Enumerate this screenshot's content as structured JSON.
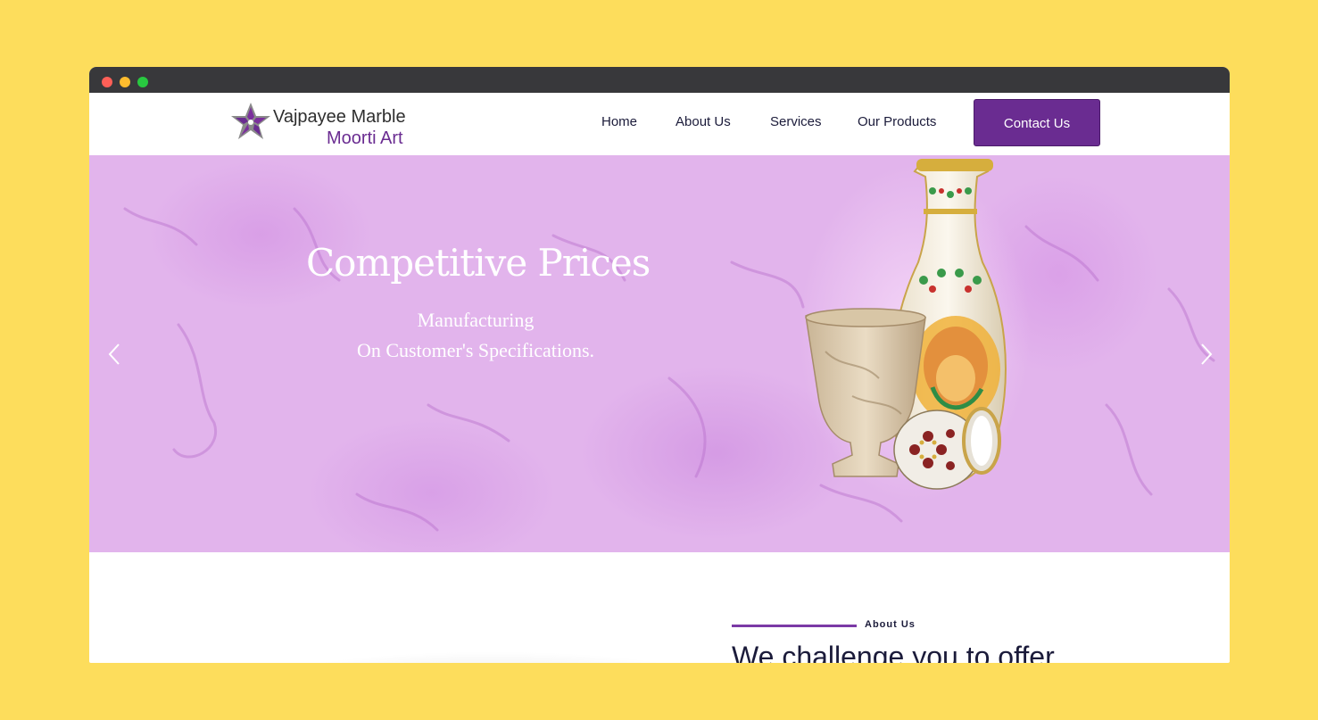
{
  "window": {
    "controls": [
      "close",
      "minimize",
      "maximize"
    ]
  },
  "header": {
    "logo": {
      "line1": "Vajpayee Marble",
      "line2": "Moorti Art",
      "icon": "star-logo-icon"
    },
    "nav": [
      {
        "label": "Home"
      },
      {
        "label": "About Us"
      },
      {
        "label": "Services"
      },
      {
        "label": "Our Products"
      }
    ],
    "cta_label": "Contact Us"
  },
  "hero": {
    "title": "Competitive Prices",
    "subtitle_line1": "Manufacturing",
    "subtitle_line2": "On Customer's Specifications.",
    "prev_icon": "chevron-left-icon",
    "next_icon": "chevron-right-icon"
  },
  "about": {
    "label": "About Us",
    "heading": "We challenge you to offer"
  },
  "colors": {
    "background": "#fddd5c",
    "brand_purple": "#6a2c91",
    "hero_bg": "#e2b4ec",
    "titlebar": "#38383b"
  }
}
